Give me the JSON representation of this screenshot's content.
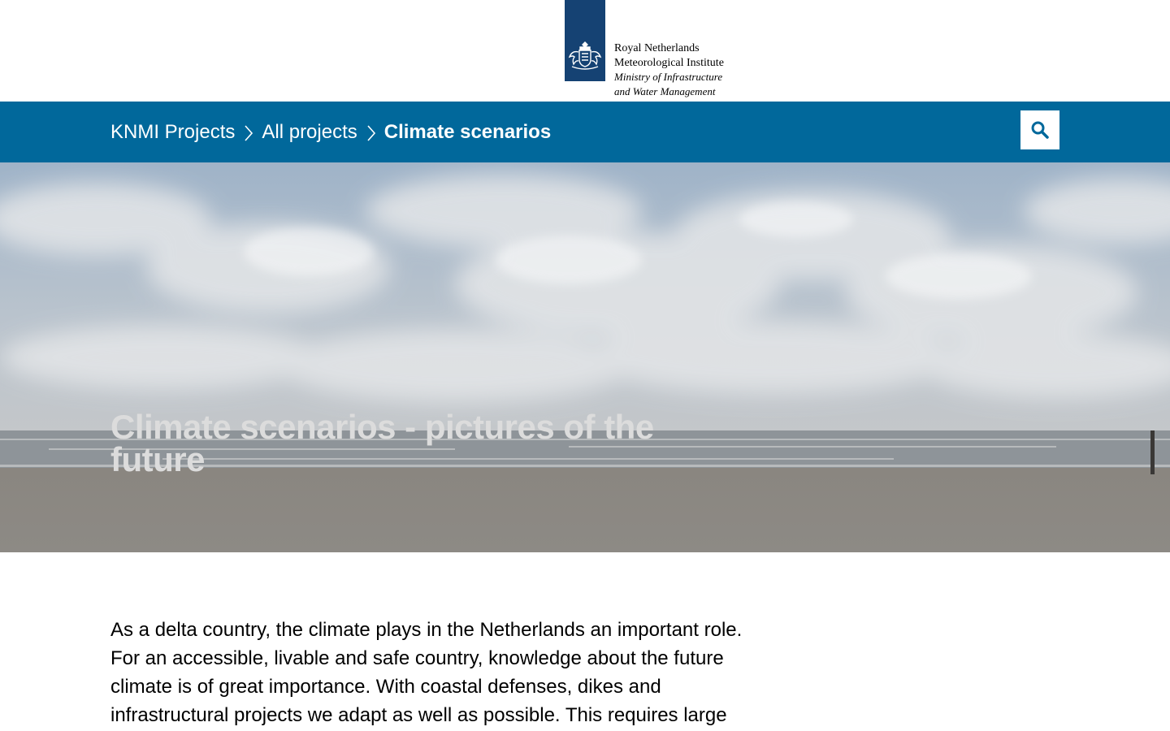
{
  "logo": {
    "lines": [
      "Royal Netherlands",
      "Meteorological Institute"
    ],
    "italic_lines": [
      "Ministry of Infrastructure",
      "and Water Management"
    ],
    "mark_color": "#154273"
  },
  "nav": {
    "bar_color": "#01689b",
    "breadcrumb": [
      {
        "label": "KNMI Projects"
      },
      {
        "label": "All projects"
      },
      {
        "label": "Climate scenarios"
      }
    ],
    "search_icon": "search-icon"
  },
  "hero": {
    "title": "Climate scenarios - pictures of the future"
  },
  "intro": {
    "text": "As a delta country, the climate plays in the Netherlands an important role. For an accessible, livable and safe country, knowledge about the future climate is of great importance. With coastal defenses, dikes and infrastructural projects we adapt as well as possible. This requires large"
  }
}
